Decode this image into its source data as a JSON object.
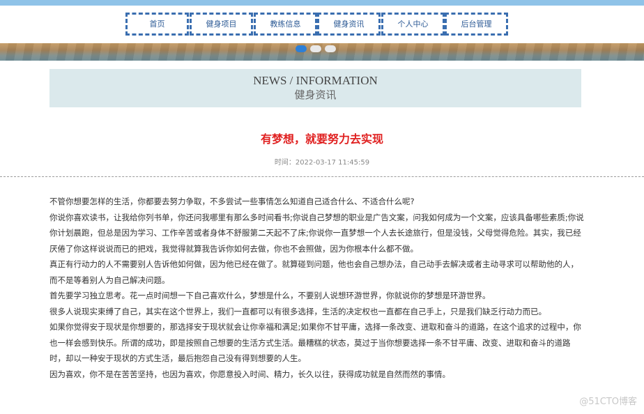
{
  "nav": {
    "items": [
      {
        "label": "首页"
      },
      {
        "label": "健身项目"
      },
      {
        "label": "教练信息"
      },
      {
        "label": "健身资讯"
      },
      {
        "label": "个人中心"
      },
      {
        "label": "后台管理"
      }
    ]
  },
  "carousel": {
    "slide_count": 3,
    "active_index": 0
  },
  "section": {
    "title_en": "NEWS / INFORMATION",
    "title_cn": "健身资讯"
  },
  "article": {
    "title": "有梦想，就要努力去实现",
    "meta": "时间：2022-03-17 11:45:59",
    "paragraphs": [
      "不管你想要怎样的生活，你都要去努力争取，不多尝试一些事情怎么知道自己适合什么、不适合什么呢?",
      "你说你喜欢读书，让我给你列书单，你还问我哪里有那么多时间看书;你说自己梦想的职业是广告文案，问我如何成为一个文案，应该具备哪些素质;你说你计划晨跑，但总是因为学习、工作辛苦或者身体不舒服第二天起不了床;你说你一直梦想一个人去长途旅行，但是没钱，父母觉得危险。其实，我已经厌倦了你这样说说而已的把戏，我觉得就算我告诉你如何去做，你也不会照做，因为你根本什么都不做。",
      "真正有行动力的人不需要别人告诉他如何做，因为他已经在做了。就算碰到问题，他也会自己想办法，自己动手去解决或者主动寻求可以帮助他的人，而不是等着别人为自己解决问题。",
      "首先要学习独立思考。花一点时间想一下自己喜欢什么，梦想是什么，不要别人说想环游世界，你就说你的梦想是环游世界。",
      "很多人说现实束缚了自己，其实在这个世界上，我们一直都可以有很多选择，生活的决定权也一直都在自己手上，只是我们缺乏行动力而已。",
      "如果你觉得安于现状是你想要的，那选择安于现状就会让你幸福和满足;如果你不甘平庸，选择一条改变、进取和奋斗的道路，在这个追求的过程中，你也一样会感到快乐。所谓的成功，即是按照自己想要的生活方式生活。最糟糕的状态，莫过于当你想要选择一条不甘平庸、改变、进取和奋斗的道路时，却以一种安于现状的方式生活，最后抱怨自己没有得到想要的人生。",
      "因为喜欢，你不是在苦苦坚持，也因为喜欢，你愿意投入时间、精力，长久以往，获得成功就是自然而然的事情。"
    ]
  },
  "watermark": "@51CTO博客"
}
